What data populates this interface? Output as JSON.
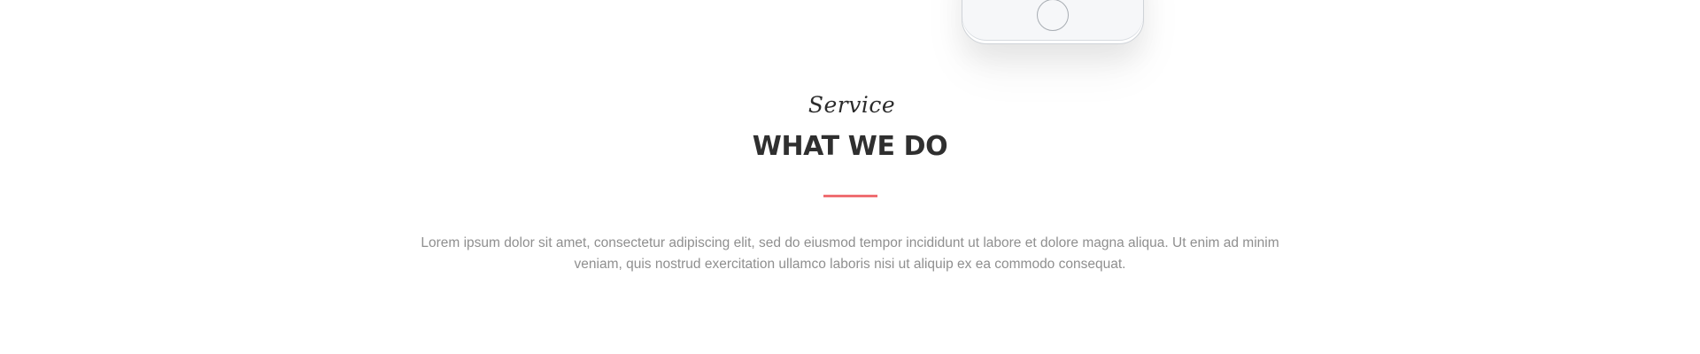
{
  "service": {
    "eyebrow": "Service",
    "title": "WHAT WE DO",
    "description": "Lorem ipsum dolor sit amet, consectetur adipiscing elit, sed do eiusmod tempor incididunt ut labore et dolore magna aliqua. Ut enim ad minim veniam, quis nostrud exercitation ullamco laboris nisi ut aliquip ex ea commodo consequat."
  },
  "colors": {
    "accent": "#ef6e72",
    "heading": "#2f2f2f",
    "body_text": "#8f8f8f",
    "background": "#ffffff"
  },
  "icons": {
    "phone": "smartphone-mockup-icon",
    "home_button": "home-button-icon"
  }
}
